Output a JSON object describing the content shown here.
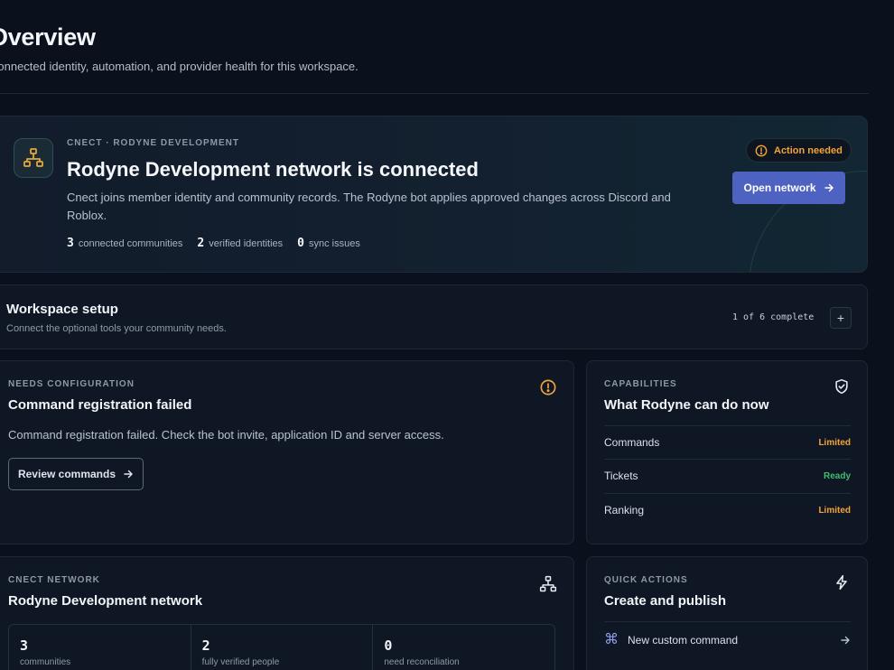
{
  "header": {
    "title": "Overview",
    "subtitle": "Connected identity, automation, and provider health for this workspace."
  },
  "hero": {
    "icon": "network-icon",
    "eyebrow": "CNECT · RODYNE DEVELOPMENT",
    "title": "Rodyne Development network is connected",
    "description": "Cnect joins member identity and community records. The Rodyne bot applies approved changes across Discord and Roblox.",
    "stats": [
      {
        "value": "3",
        "label": "connected communities"
      },
      {
        "value": "2",
        "label": "verified identities"
      },
      {
        "value": "0",
        "label": "sync issues"
      }
    ],
    "badge": "Action needed",
    "badge_color": "#f2a33a",
    "button": "Open network",
    "accent": "#4d62c1"
  },
  "setup": {
    "title": "Workspace setup",
    "subtitle": "Connect the optional tools your community needs.",
    "progress": "1 of 6 complete",
    "expand": "+"
  },
  "command_card": {
    "eyebrow": "NEEDS CONFIGURATION",
    "title": "Command registration failed",
    "description": "Command registration failed. Check the bot invite, application ID and server access.",
    "button": "Review commands",
    "icon": "warning-icon"
  },
  "capabilities": {
    "eyebrow": "CAPABILITIES",
    "title": "What Rodyne can do now",
    "icon": "shield-check-icon",
    "items": [
      {
        "label": "Commands",
        "status": "Limited",
        "color": "#f2a33a"
      },
      {
        "label": "Tickets",
        "status": "Ready",
        "color": "#3fbf6f"
      },
      {
        "label": "Ranking",
        "status": "Limited",
        "color": "#f2a33a"
      }
    ]
  },
  "network": {
    "eyebrow": "CNECT NETWORK",
    "title": "Rodyne Development network",
    "icon": "network-icon",
    "stats": [
      {
        "value": "3",
        "label": "communities"
      },
      {
        "value": "2",
        "label": "fully verified people"
      },
      {
        "value": "0",
        "label": "need reconciliation"
      }
    ]
  },
  "quick_actions": {
    "eyebrow": "QUICK ACTIONS",
    "title": "Create and publish",
    "icon": "lightning-icon",
    "items": [
      {
        "label": "New custom command",
        "icon": "command-icon"
      }
    ]
  }
}
